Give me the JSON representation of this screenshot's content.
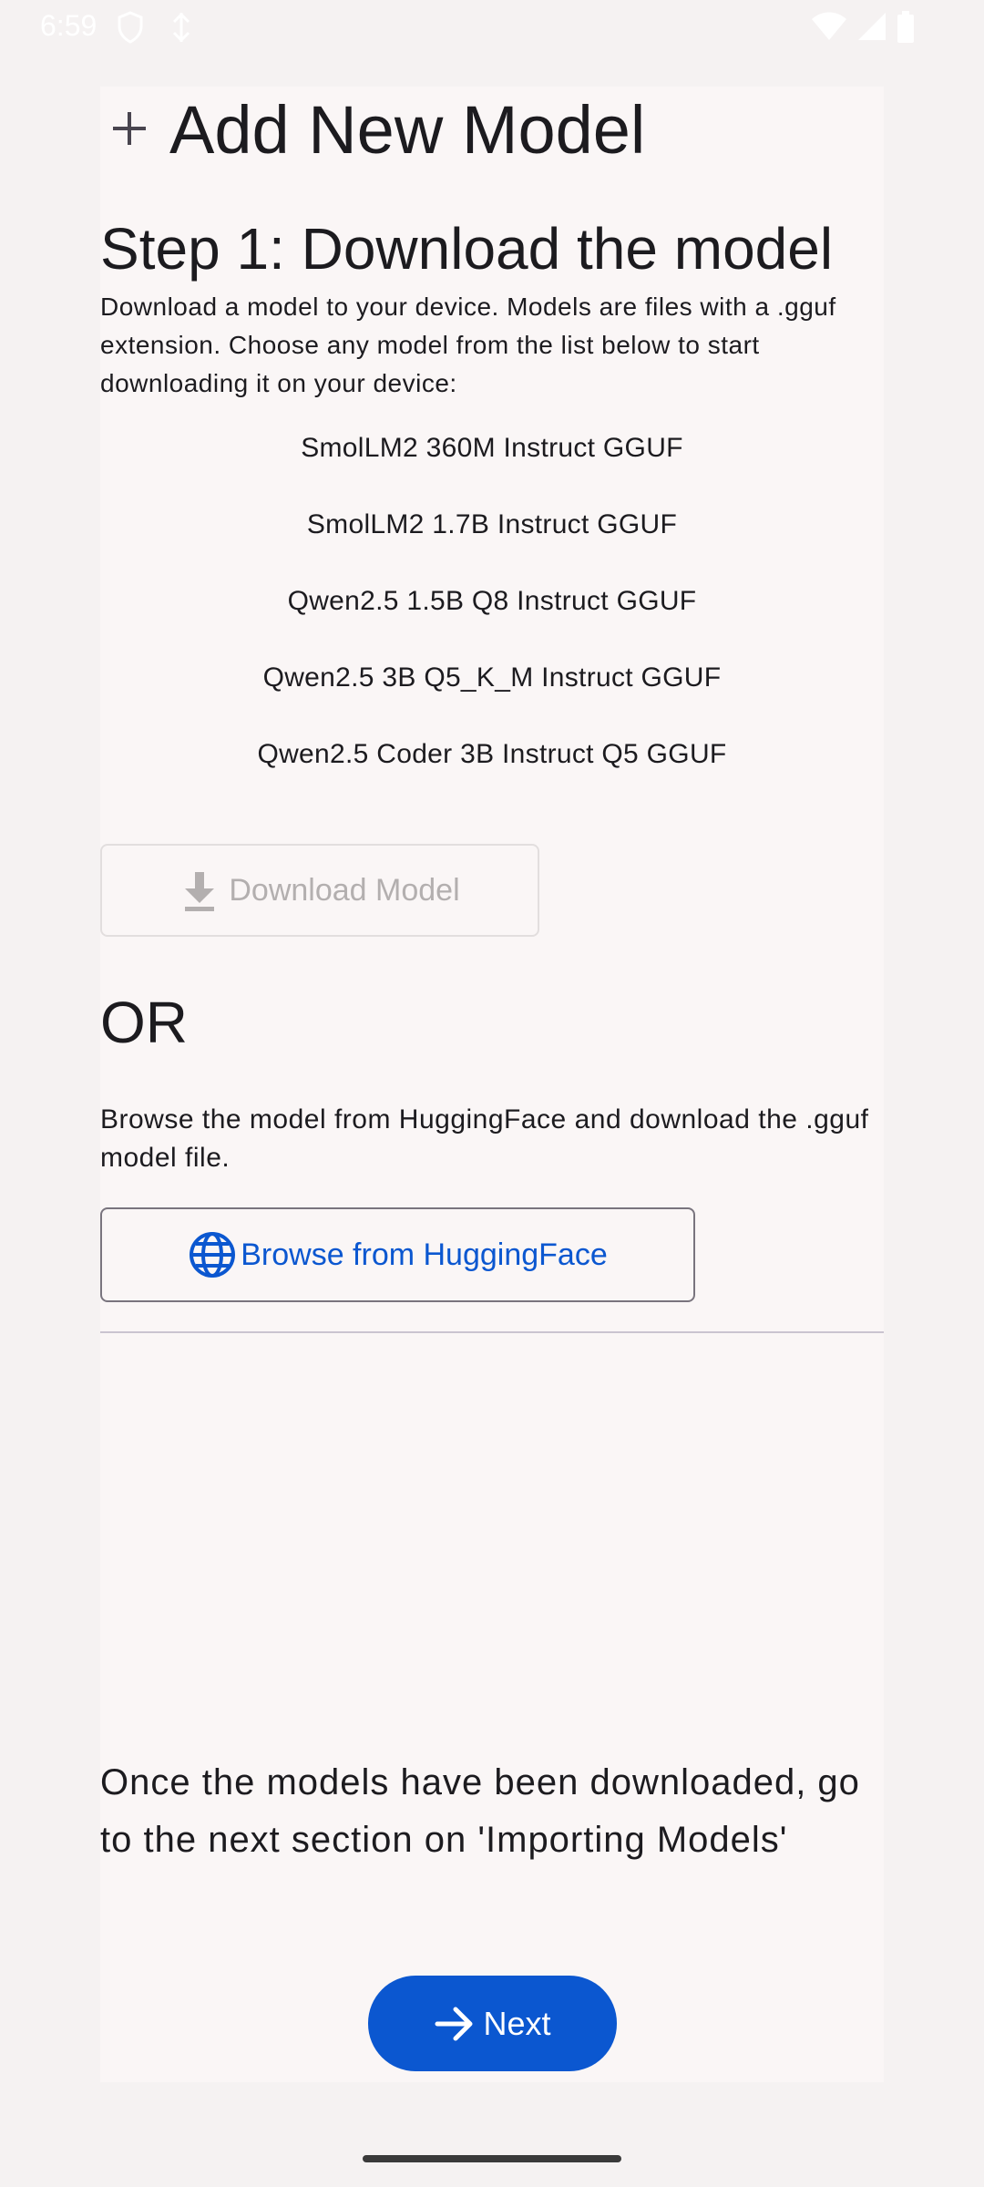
{
  "status_bar": {
    "time": "6:59"
  },
  "header": {
    "title": "Add New Model",
    "icon": "plus-icon"
  },
  "step1": {
    "title": "Step 1: Download the model",
    "description": "Download a model to your device. Models are files with a .gguf extension. Choose any model from the list below to start downloading it on your device:",
    "models": [
      "SmolLM2 360M Instruct GGUF",
      "SmolLM2 1.7B Instruct GGUF",
      "Qwen2.5 1.5B Q8 Instruct GGUF",
      "Qwen2.5 3B Q5_K_M Instruct GGUF",
      "Qwen2.5 Coder 3B Instruct Q5 GGUF"
    ],
    "download_label": "Download Model"
  },
  "or_section": {
    "or_label": "OR",
    "browse_description": "Browse the model from HuggingFace and download the .gguf model file.",
    "browse_label": "Browse from HuggingFace"
  },
  "footer": {
    "note": "Once the models have been downloaded, go to the next section on 'Importing Models'",
    "next_label": "Next"
  },
  "colors": {
    "accent": "#0b57d0",
    "background": "#f5f2f2",
    "card": "#faf6f6",
    "disabled": "#b3afaf"
  }
}
